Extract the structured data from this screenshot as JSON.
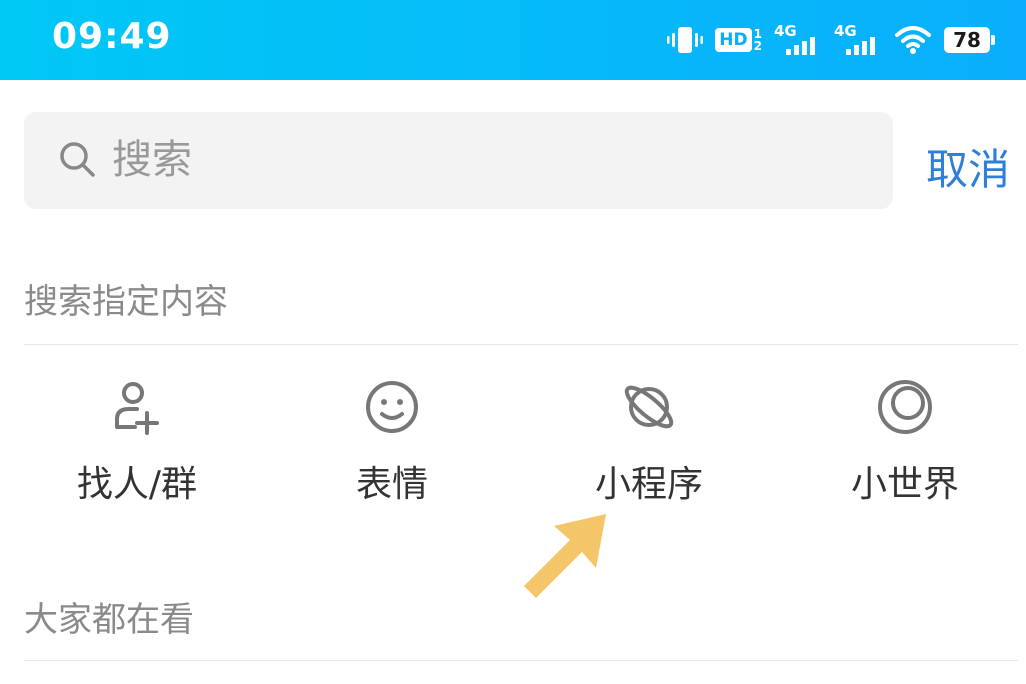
{
  "status_bar": {
    "time": "09:49",
    "hd_label": "HD",
    "sim_indices": [
      "1",
      "2"
    ],
    "network_labels": [
      "4G",
      "4G"
    ],
    "battery": "78",
    "icons": [
      "vibrate-icon",
      "hd-icon",
      "signal-icon",
      "signal-icon",
      "wifi-icon",
      "battery-icon"
    ]
  },
  "search": {
    "placeholder": "搜索",
    "value": "",
    "cancel_label": "取消"
  },
  "specified_section": {
    "title": "搜索指定内容",
    "categories": [
      {
        "label": "找人/群",
        "icon": "add-contact-icon"
      },
      {
        "label": "表情",
        "icon": "smiley-icon"
      },
      {
        "label": "小程序",
        "icon": "planet-icon"
      },
      {
        "label": "小世界",
        "icon": "moon-circle-icon"
      }
    ]
  },
  "trending_section": {
    "title": "大家都在看"
  },
  "colors": {
    "status_bar_start": "#00c8f5",
    "status_bar_end": "#0aaefc",
    "accent": "#2f7fd8",
    "pointer_arrow": "#f5c56a",
    "icon_gray": "#777777"
  }
}
